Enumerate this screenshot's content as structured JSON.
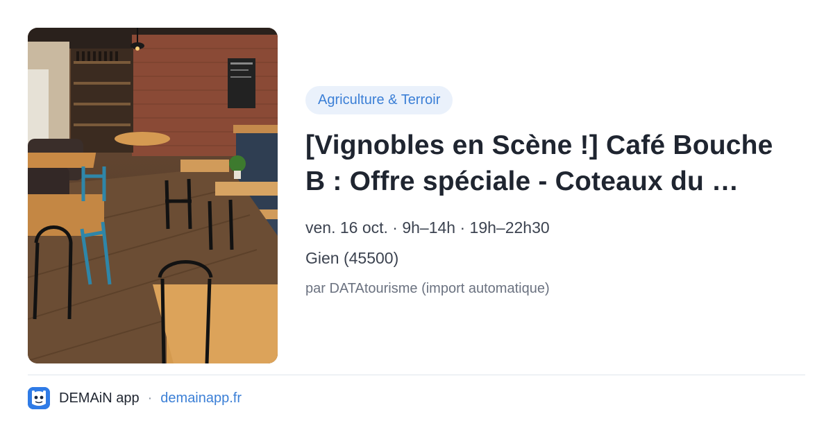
{
  "photo": {
    "subject": "cafe-restaurant-interior"
  },
  "tag": {
    "label": "Agriculture & Terroir",
    "color": "#3b7fd6",
    "background": "#eaf1fb"
  },
  "event": {
    "title_line1": "[Vignobles en Scène !] Café Bouche",
    "title_line2": "B : Offre spéciale - Coteaux du …",
    "date": "ven. 16 oct. · 9h–14h · 19h–22h30",
    "place": "Gien (45500)",
    "author": "par DATAtourisme (import automatique)"
  },
  "footer": {
    "app_name": "DEMAiN app",
    "separator": "·",
    "site": "demainapp.fr",
    "icon": "demain-app-icon",
    "accent": "#2f7be6"
  }
}
